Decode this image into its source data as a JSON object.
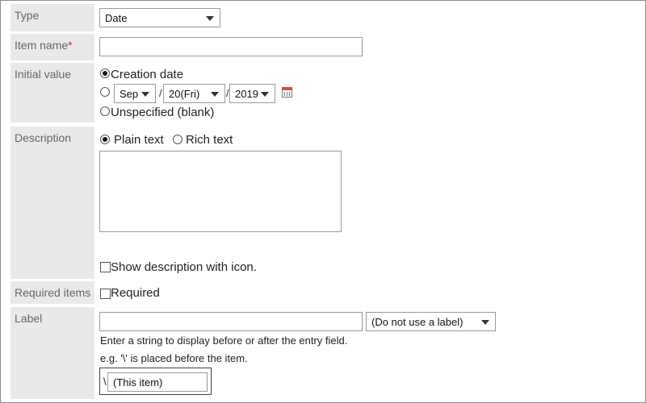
{
  "type": {
    "label": "Type",
    "value": "Date"
  },
  "item_name": {
    "label": "Item name",
    "required_mark": "*",
    "value": ""
  },
  "initial_value": {
    "label": "Initial value",
    "option_creation": "Creation date",
    "month": "Sep",
    "day": "20(Fri)",
    "year": "2019",
    "slash": "/",
    "option_unspecified": "Unspecified (blank)"
  },
  "description": {
    "label": "Description",
    "plain_text": "Plain text",
    "rich_text": "Rich text",
    "show_icon": "Show description with icon."
  },
  "required_items": {
    "label": "Required items",
    "required": "Required"
  },
  "label_row": {
    "label": "Label",
    "input_value": "",
    "position": "(Do not use a label)",
    "hint": "Enter a string to display before or after the entry field.",
    "example": "e.g.  '\\' is placed before the item.",
    "preview_prefix": "\\",
    "preview_item": "(This item)"
  },
  "colors": {
    "label_bg": "#e9e9e9",
    "label_text": "#666666",
    "required_star": "#dd3333",
    "calendar_icon": "#d34b3f"
  }
}
